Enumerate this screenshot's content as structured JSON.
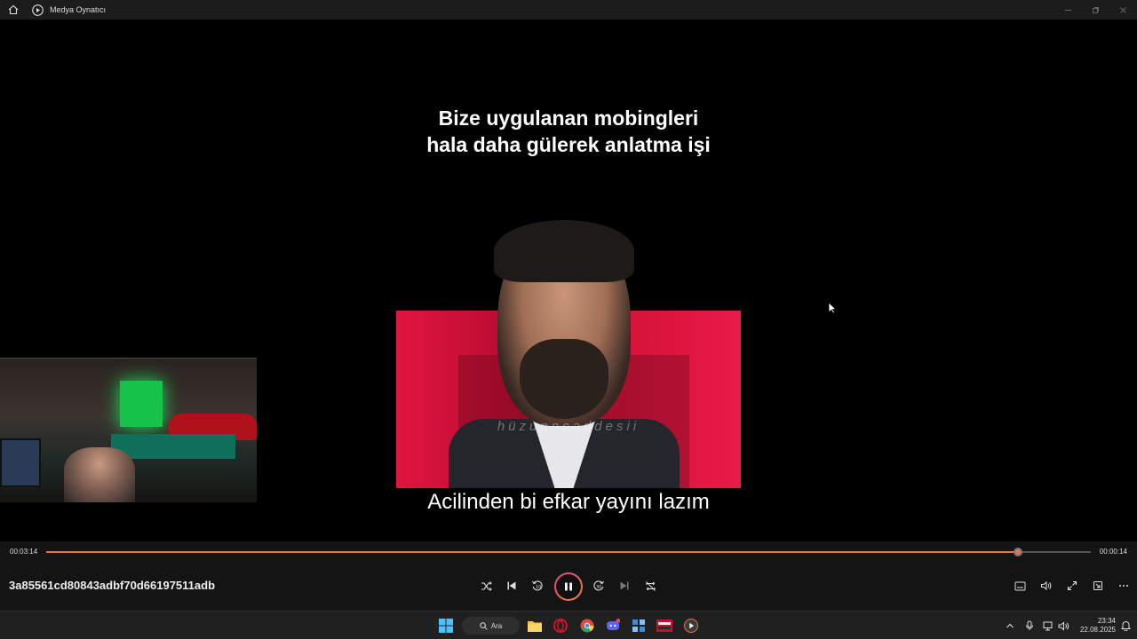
{
  "window": {
    "title": "Medya Oynatıcı"
  },
  "video": {
    "caption_top_line1": "Bize uygulanan mobingleri",
    "caption_top_line2": "hala daha gülerek anlatma işi",
    "watermark": "hüzunncaddesii",
    "subtitle": "Acilinden bi efkar yayını lazım"
  },
  "player": {
    "current_time": "00:03:14",
    "remaining_time": "00:00:14",
    "progress_fraction": 0.93,
    "file_name": "3a85561cd80843adbf70d66197511adb",
    "accent_color": "#e8744a"
  },
  "taskbar": {
    "search_label": "Ara",
    "clock_time": "23:34",
    "clock_date": "22.08.2025"
  }
}
